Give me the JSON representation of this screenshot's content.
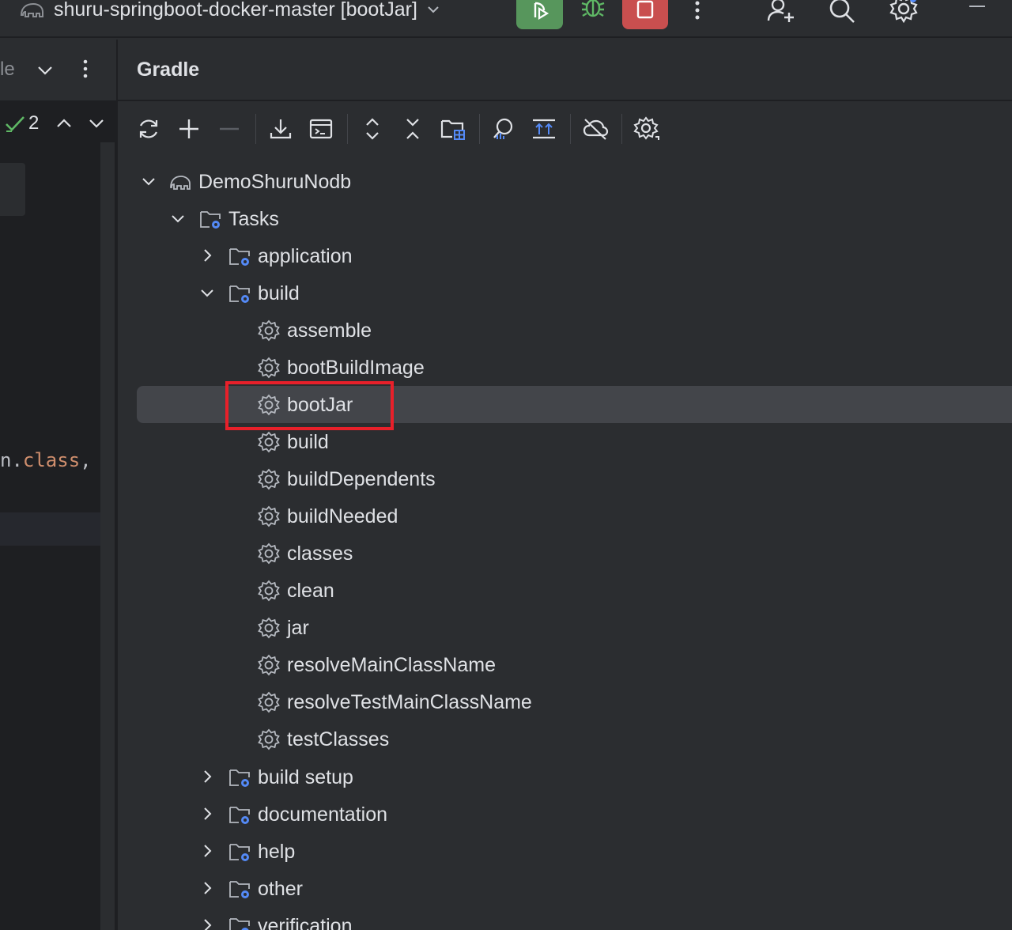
{
  "titlebar": {
    "config_name": "shuru-springboot-docker-master [bootJar]",
    "run_color": "#57965c",
    "stop_color": "#c94f4f"
  },
  "editor": {
    "tab_fragment": "le",
    "inspection_count": "2",
    "code_fragment_prefix": "n.",
    "code_fragment_keyword": "class",
    "code_fragment_suffix": ", a"
  },
  "gradle": {
    "title": "Gradle",
    "toolbar": [
      {
        "name": "reload-icon"
      },
      {
        "name": "add-icon"
      },
      {
        "name": "remove-icon"
      },
      {
        "name": "download-sources-icon"
      },
      {
        "name": "execute-task-icon"
      },
      {
        "name": "expand-all-icon"
      },
      {
        "name": "collapse-all-icon"
      },
      {
        "name": "group-modules-icon"
      },
      {
        "name": "analyze-dependencies-icon"
      },
      {
        "name": "show-dependencies-icon"
      },
      {
        "name": "offline-mode-icon"
      },
      {
        "name": "build-tool-settings-icon"
      }
    ],
    "tree": {
      "project": "DemoShuruNodb",
      "tasks_label": "Tasks",
      "groups_before": [
        "application"
      ],
      "build_group": "build",
      "build_tasks": [
        "assemble",
        "bootBuildImage",
        "bootJar",
        "build",
        "buildDependents",
        "buildNeeded",
        "classes",
        "clean",
        "jar",
        "resolveMainClassName",
        "resolveTestMainClassName",
        "testClasses"
      ],
      "groups_after": [
        "build setup",
        "documentation",
        "help",
        "other",
        "verification"
      ],
      "selected": "bootJar"
    },
    "highlight_color": "#e8202a"
  }
}
